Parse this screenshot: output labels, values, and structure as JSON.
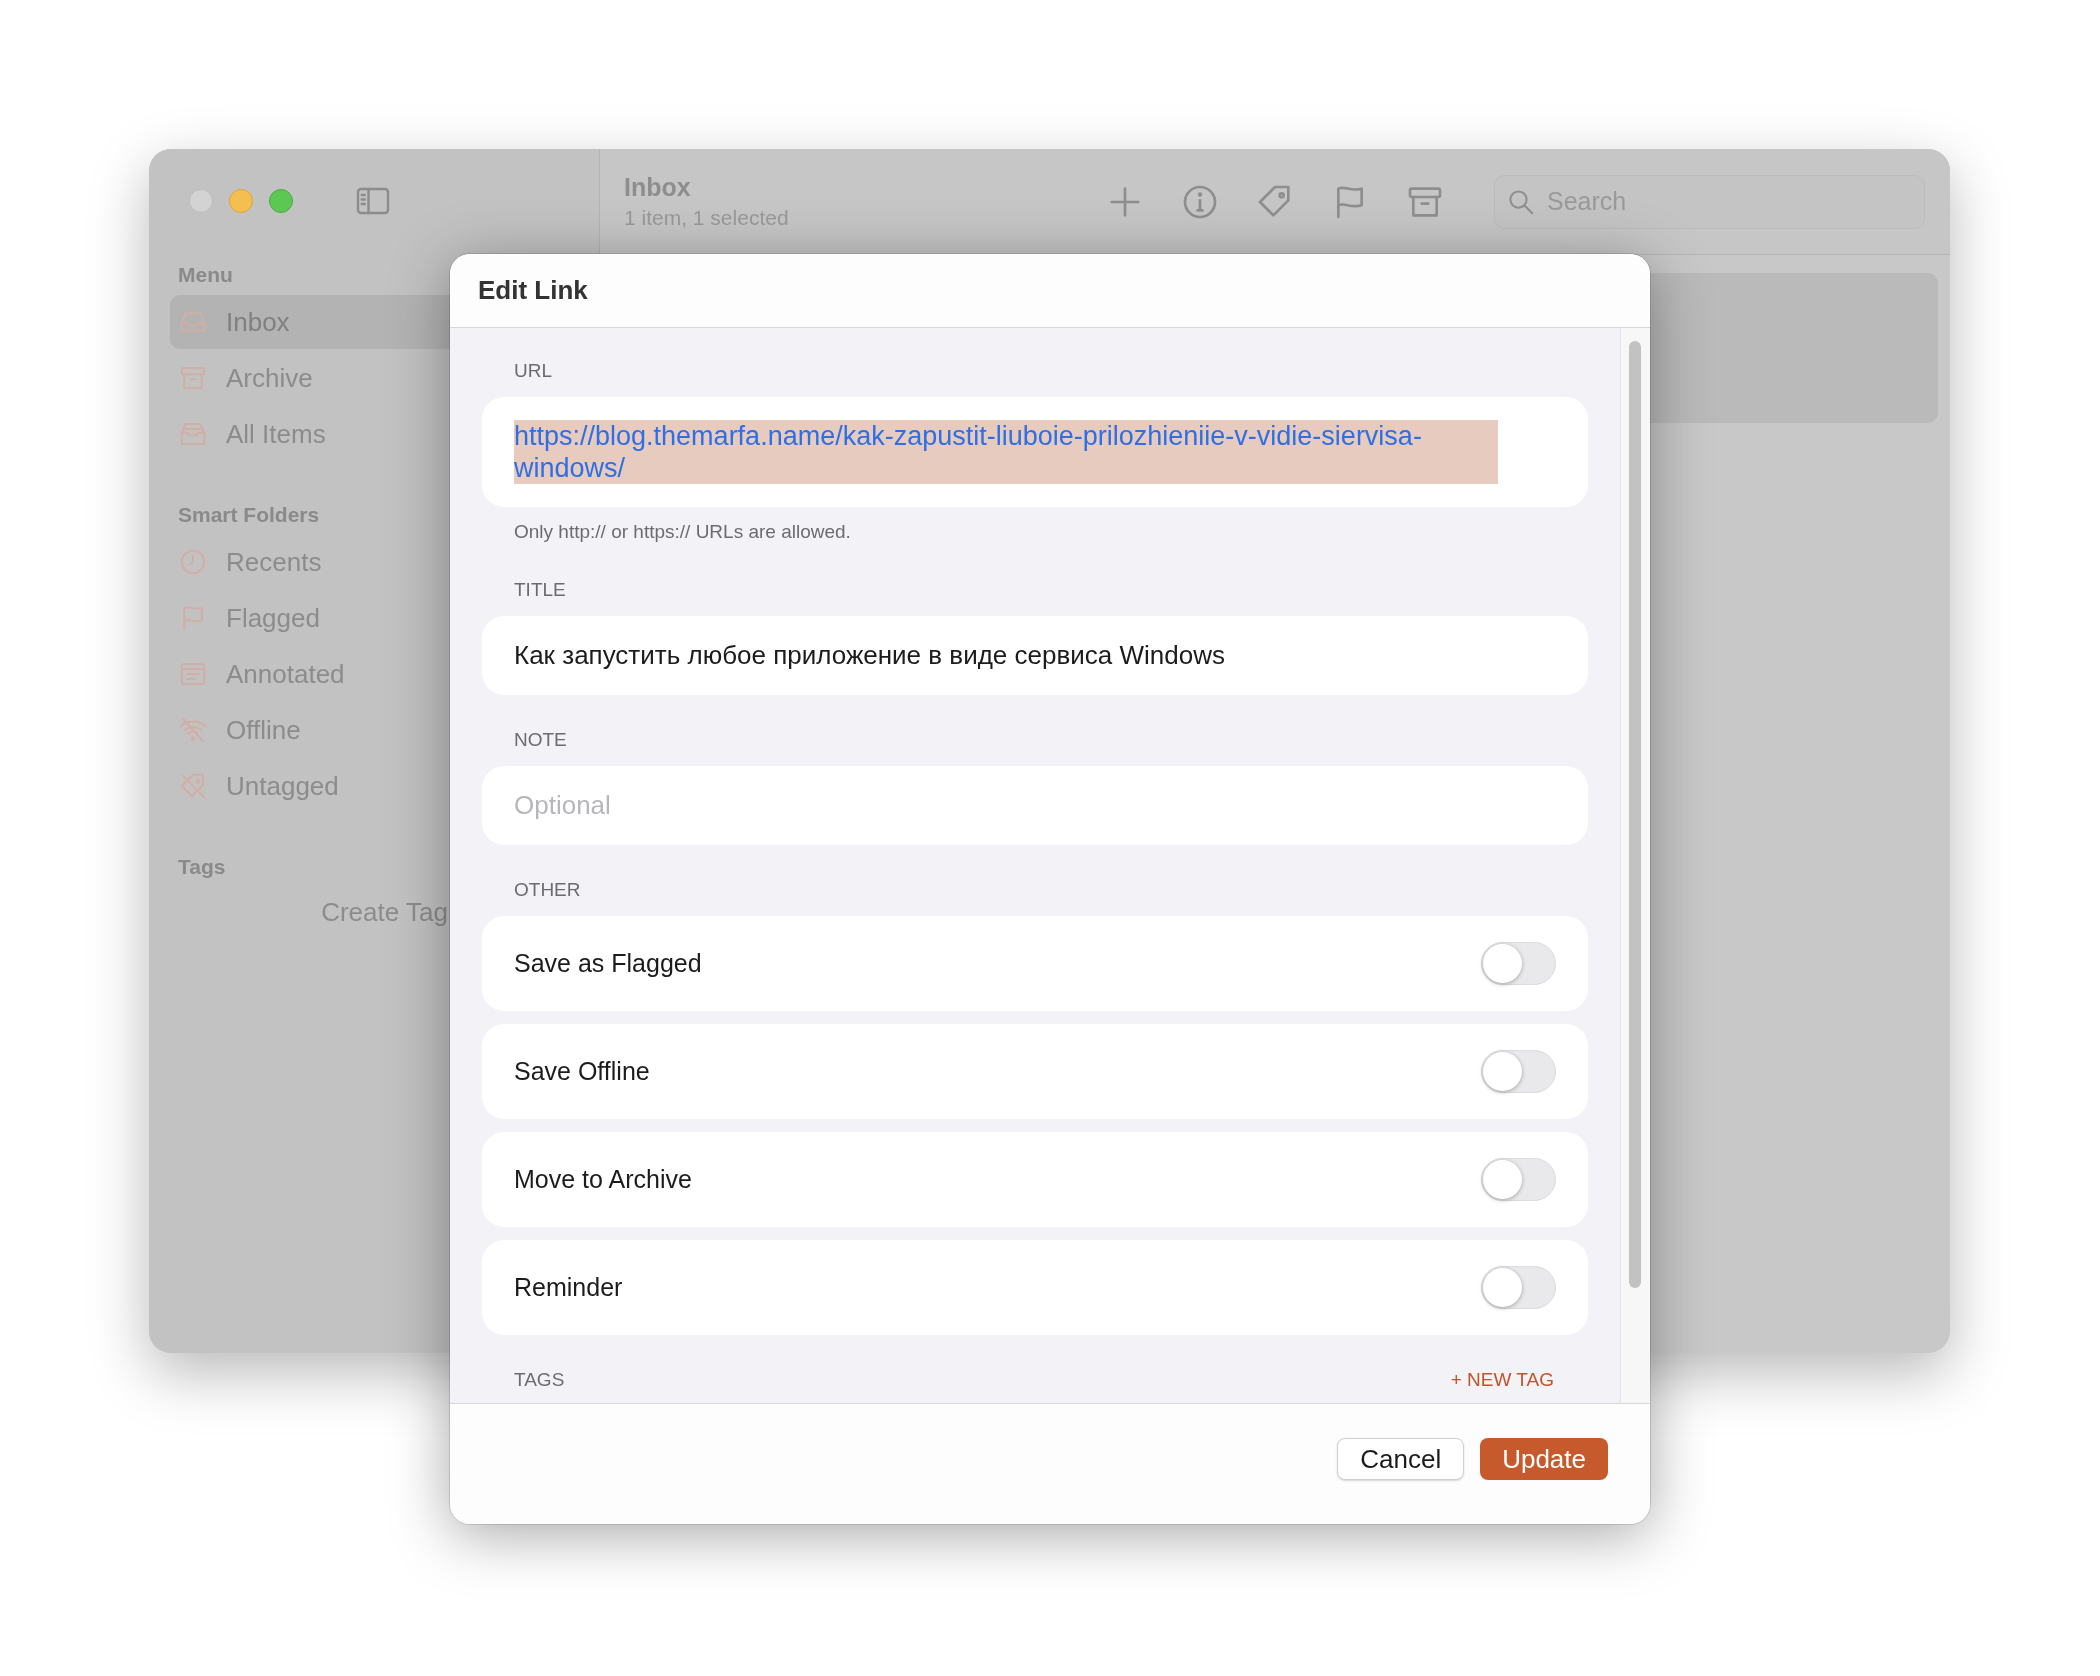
{
  "window": {
    "toolbar": {
      "title": "Inbox",
      "subtitle": "1 item, 1 selected",
      "search": {
        "placeholder": "Search"
      }
    },
    "sidebar": {
      "sections": [
        {
          "heading": "Menu",
          "items": [
            {
              "label": "Inbox",
              "selected": true
            },
            {
              "label": "Archive",
              "selected": false
            },
            {
              "label": "All Items",
              "selected": false
            }
          ]
        },
        {
          "heading": "Smart Folders",
          "items": [
            {
              "label": "Recents",
              "selected": false
            },
            {
              "label": "Flagged",
              "selected": false
            },
            {
              "label": "Annotated",
              "selected": false
            },
            {
              "label": "Offline",
              "selected": false
            },
            {
              "label": "Untagged",
              "selected": false
            }
          ]
        },
        {
          "heading": "Tags"
        }
      ],
      "create_tag": "Create Tag"
    },
    "list": {
      "rows": [
        {
          "selected": true
        }
      ]
    }
  },
  "dialog": {
    "title": "Edit Link",
    "url": {
      "label": "URL",
      "value": "https://blog.themarfa.name/kak-zapustit-liuboie-prilozhieniie-v-vidie-siervisa-windows/",
      "text_selected": true,
      "hint": "Only http:// or https:// URLs are allowed."
    },
    "title_field": {
      "label": "TITLE",
      "value": "Как запустить любое приложение в виде сервиса Windows"
    },
    "note": {
      "label": "NOTE",
      "placeholder": "Optional"
    },
    "other": {
      "label": "OTHER",
      "toggles": [
        {
          "label": "Save as Flagged",
          "on": false
        },
        {
          "label": "Save Offline",
          "on": false
        },
        {
          "label": "Move to Archive",
          "on": false
        },
        {
          "label": "Reminder",
          "on": false
        }
      ]
    },
    "tags": {
      "label": "TAGS",
      "action": "+ NEW TAG"
    },
    "buttons": [
      {
        "label": "Cancel",
        "kind": "secondary"
      },
      {
        "label": "Update",
        "kind": "primary"
      }
    ]
  }
}
